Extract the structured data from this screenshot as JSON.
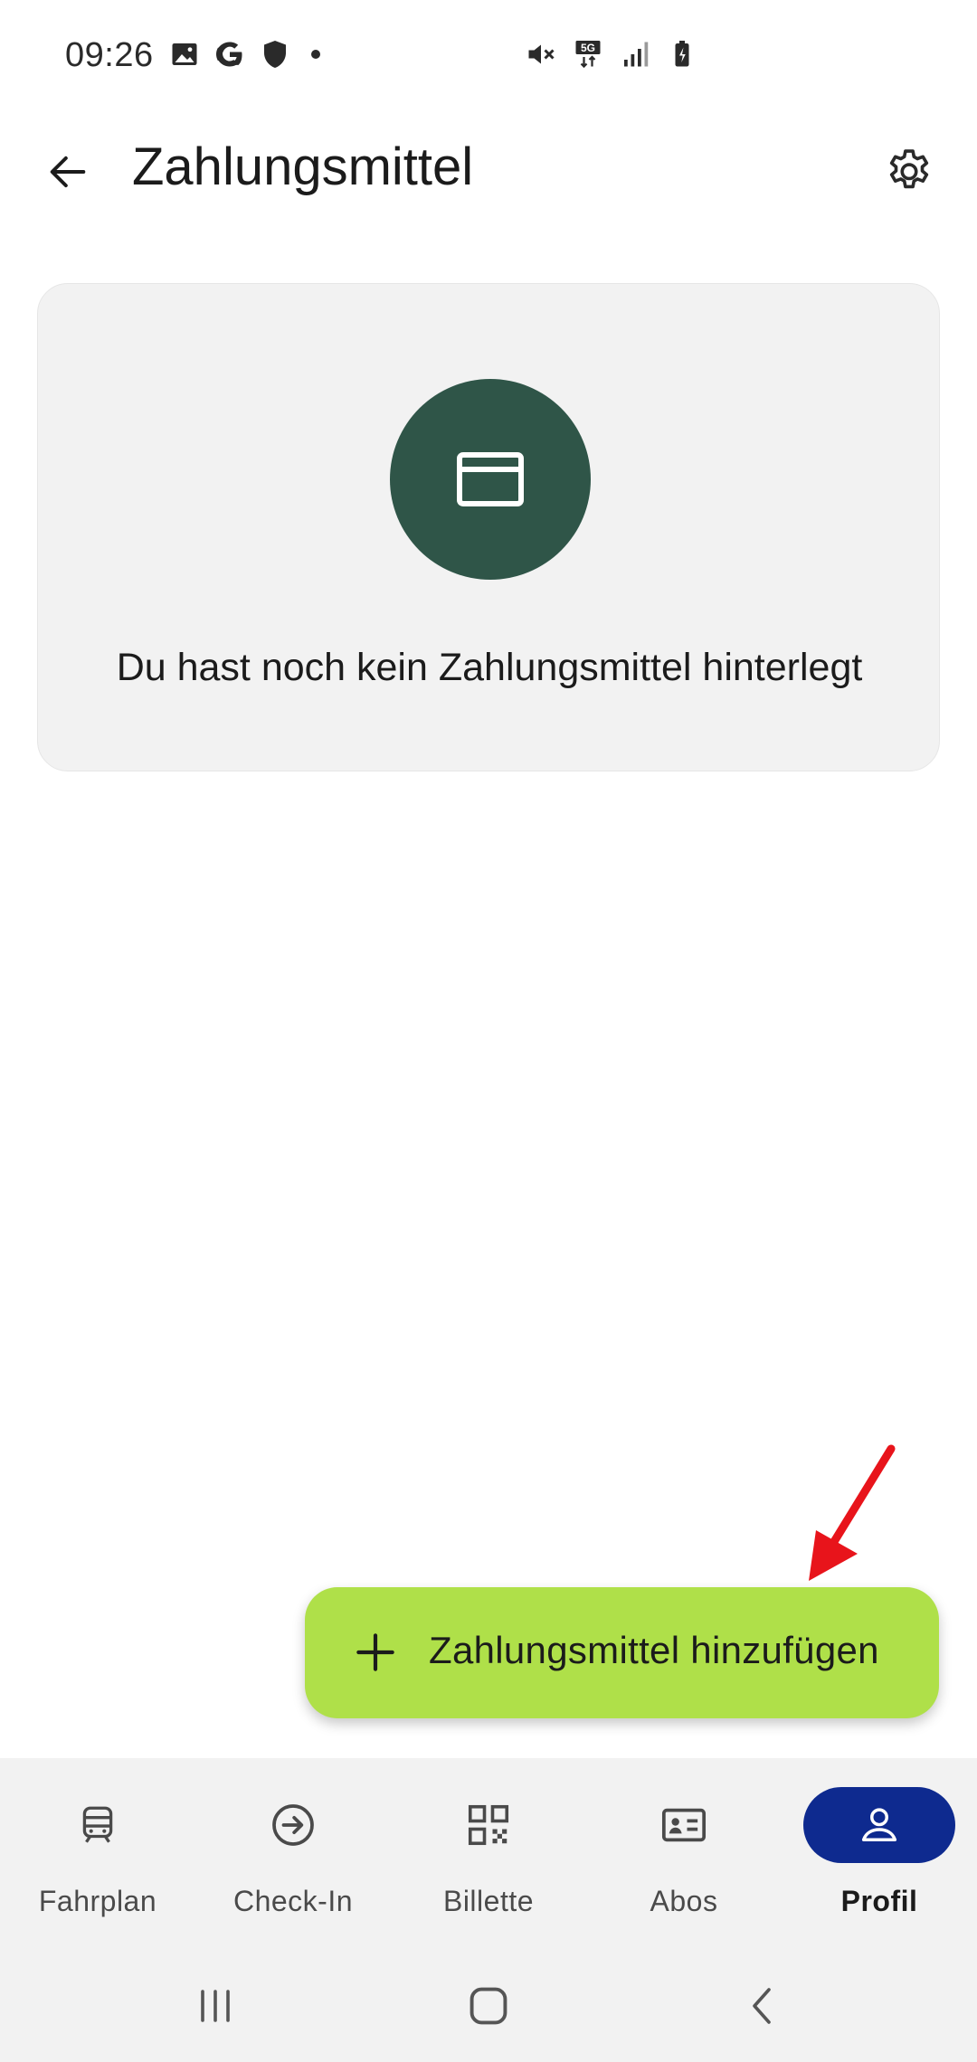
{
  "status_bar": {
    "time": "09:26",
    "left_icons": [
      "image-icon",
      "google-icon",
      "shield-icon",
      "notification-dot"
    ],
    "right_icons": [
      "mute-icon",
      "5g-icon",
      "signal-icon",
      "battery-icon"
    ],
    "network_label": "5G"
  },
  "appbar": {
    "title": "Zahlungsmittel",
    "back_icon": "arrow-left-icon",
    "settings_icon": "gear-icon"
  },
  "empty_state": {
    "icon": "credit-card-icon",
    "message": "Du hast noch kein Zahlungsmittel hinterlegt",
    "accent_color": "#2f5548"
  },
  "fab": {
    "icon": "plus-icon",
    "label": "Zahlungsmittel hinzufügen",
    "color": "#afe049"
  },
  "bottom_nav": {
    "active_color": "#0e2a8f",
    "items": [
      {
        "label": "Fahrplan",
        "icon": "train-icon",
        "active": false
      },
      {
        "label": "Check-In",
        "icon": "arrow-circle-icon",
        "active": false
      },
      {
        "label": "Billette",
        "icon": "qr-code-icon",
        "active": false
      },
      {
        "label": "Abos",
        "icon": "id-card-icon",
        "active": false
      },
      {
        "label": "Profil",
        "icon": "person-icon",
        "active": true
      }
    ]
  },
  "system_nav": {
    "buttons": [
      "recents-icon",
      "home-icon",
      "back-icon"
    ]
  },
  "annotation": {
    "icon": "red-arrow-icon",
    "color": "#e8141b"
  }
}
